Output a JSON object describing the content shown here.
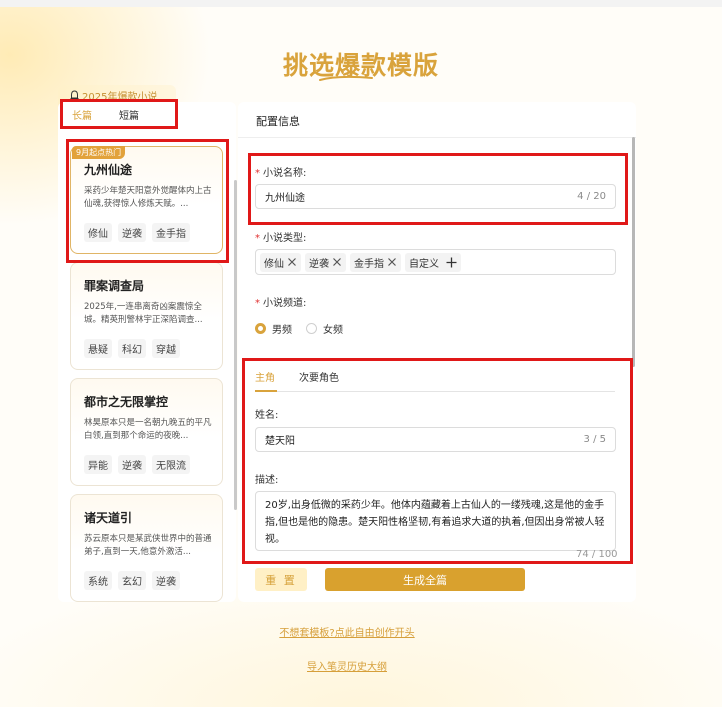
{
  "page": {
    "title": "挑选爆款模版",
    "ribbon": "2025年爆款小说"
  },
  "tabs": {
    "long": "长篇",
    "short": "短篇"
  },
  "cards": [
    {
      "badge": "9月起点热门",
      "title": "九州仙途",
      "desc": "采药少年楚天阳意外觉醒体内上古仙魂,获得惊人修炼天赋。...",
      "tags": [
        "修仙",
        "逆袭",
        "金手指"
      ]
    },
    {
      "badge": "",
      "title": "罪案调查局",
      "desc": "2025年,一连串离奇凶案震惊全城。精英刑警林宇正深陷调查...",
      "tags": [
        "悬疑",
        "科幻",
        "穿越"
      ]
    },
    {
      "badge": "",
      "title": "都市之无限掌控",
      "desc": "林昊原本只是一名朝九晚五的平凡白领,直到那个命运的夜晚...",
      "tags": [
        "异能",
        "逆袭",
        "无限流"
      ]
    },
    {
      "badge": "",
      "title": "诸天道引",
      "desc": "苏云原本只是某武侠世界中的普通弟子,直到一天,他意外激活...",
      "tags": [
        "系统",
        "玄幻",
        "逆袭"
      ]
    }
  ],
  "config": {
    "title": "配置信息",
    "name_label": "小说名称:",
    "name_value": "九州仙途",
    "name_count": "4 / 20",
    "type_label": "小说类型:",
    "type_tags": [
      "修仙",
      "逆袭",
      "金手指"
    ],
    "custom": "自定义",
    "channel_label": "小说频道:",
    "channels": [
      "男频",
      "女频"
    ]
  },
  "role": {
    "tabs": [
      "主角",
      "次要角色"
    ],
    "name_label": "姓名:",
    "name_value": "楚天阳",
    "name_count": "3 / 5",
    "desc_label": "描述:",
    "desc_value": "20岁,出身低微的采药少年。他体内蕴藏着上古仙人的一缕残魂,这是他的金手指,但也是他的隐患。楚天阳性格坚韧,有着追求大道的执着,但因出身常被人轻视。",
    "desc_count": "74 / 100"
  },
  "actions": {
    "reset": "重 置",
    "generate": "生成全篇"
  },
  "links": {
    "free": "不想套模板?点此自由创作开头",
    "import": "导入笔灵历史大纲"
  },
  "colors": {
    "accent": "#d9a33c",
    "highlight": "#e01818"
  }
}
